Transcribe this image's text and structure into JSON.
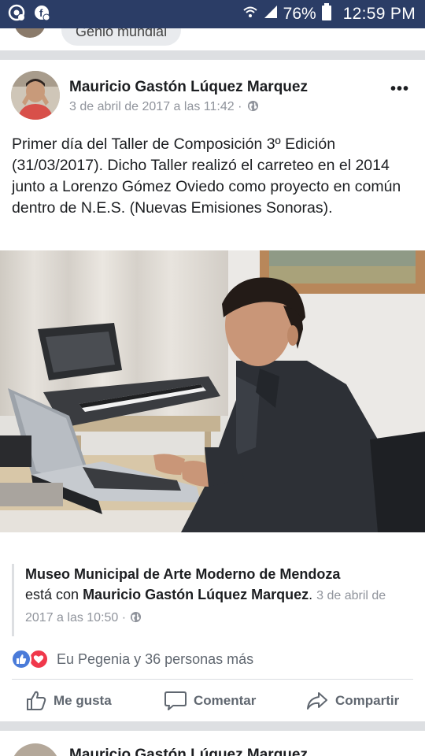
{
  "status_bar": {
    "battery": "76%",
    "time": "12:59 PM"
  },
  "top_remnant": {
    "chip_text": "Genio mundial"
  },
  "post": {
    "author": "Mauricio Gastón Lúquez Marquez",
    "timestamp": "3 de abril de 2017 a las 11:42 ·",
    "privacy_icon": "globe-icon",
    "more_label": "•••",
    "text": "Primer día del Taller de Composición 3º Edición (31/03/2017). Dicho Taller realizó el carreteo en el 2014 junto a Lorenzo Gómez Oviedo como proyecto en común dentro de N.E.S. (Nuevas Emisiones Sonoras)."
  },
  "shared": {
    "page_name": "Museo Municipal de Arte Moderno de Mendoza",
    "with_text": "está con",
    "tagged": "Mauricio Gastón Lúquez Marquez",
    "period": ".",
    "timestamp": "3 de abril de 2017 a las 10:50 ·"
  },
  "reactions": {
    "summary": "Eu Pegenia y 36 personas más",
    "like_color": "#4a7bd9",
    "love_color": "#f0384b"
  },
  "actions": {
    "like": "Me gusta",
    "comment": "Comentar",
    "share": "Compartir"
  },
  "next_post": {
    "author": "Mauricio Gastón Lúquez Marquez"
  },
  "colors": {
    "status_bar": "#2b3d66",
    "divider": "#dddfe2",
    "meta_gray": "#90949c",
    "action_gray": "#606770"
  }
}
